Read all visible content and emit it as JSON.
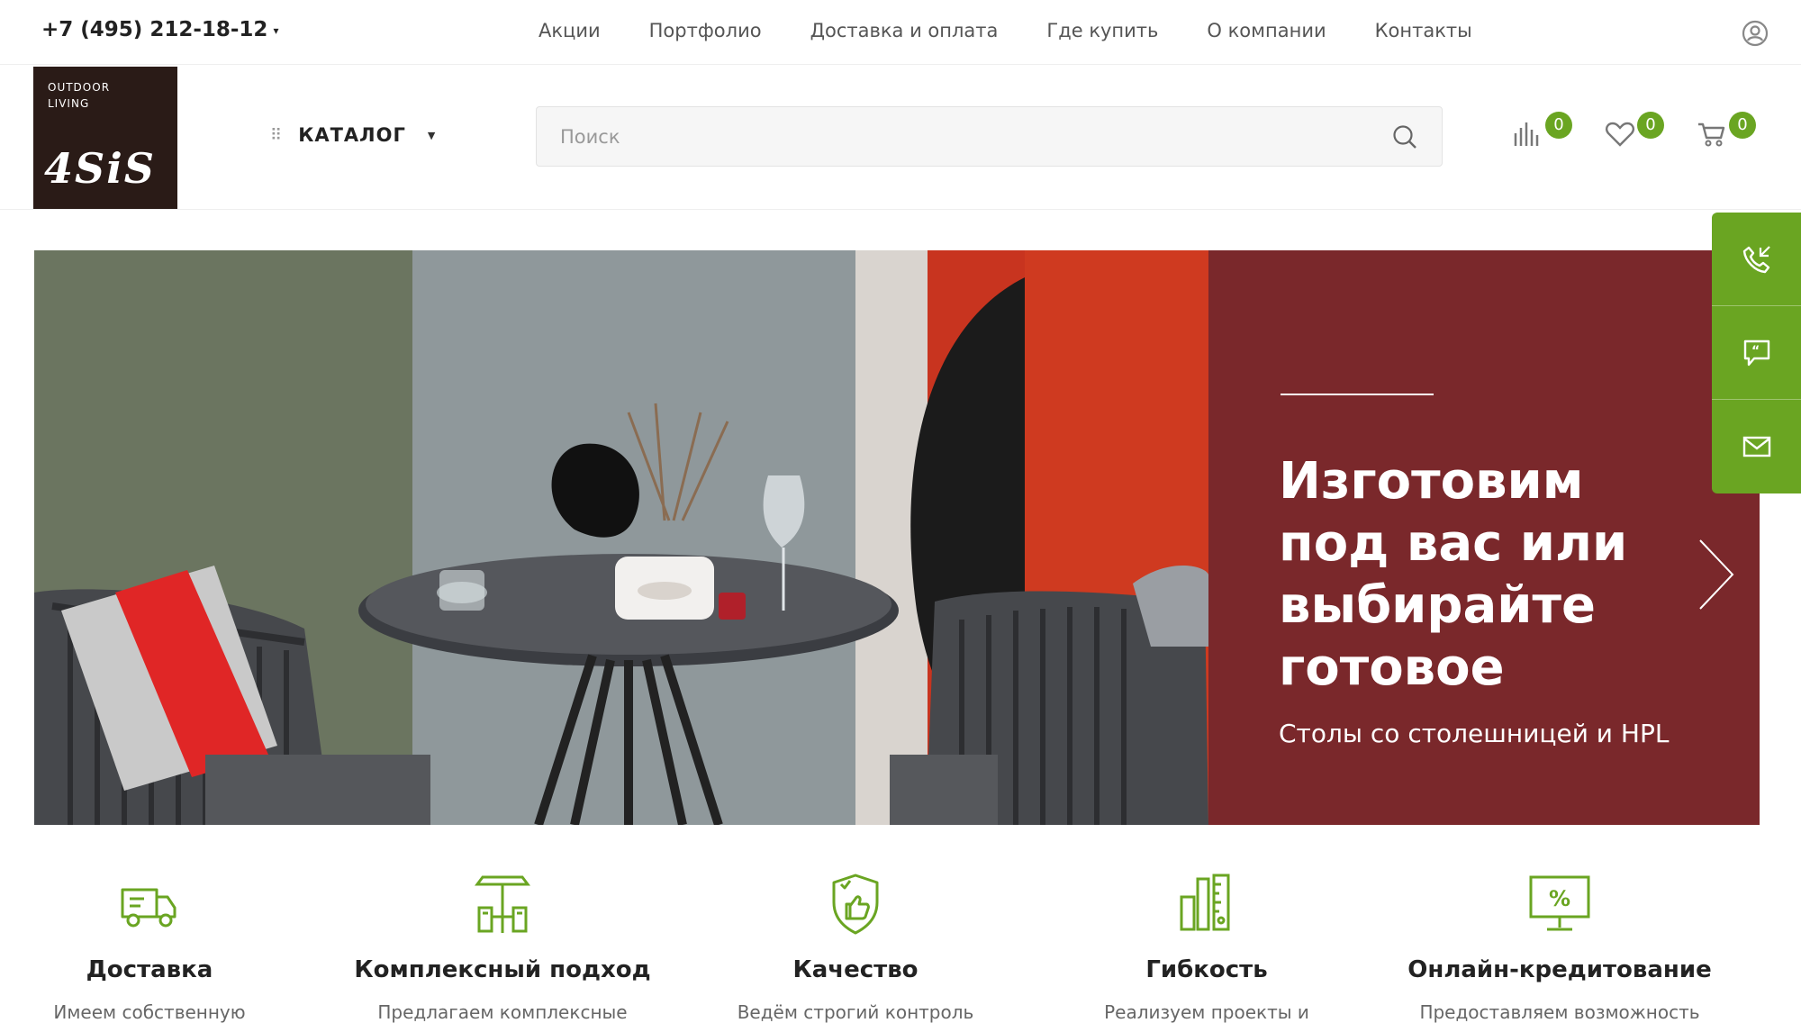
{
  "topbar": {
    "phone": "+7 (495) 212-18-12",
    "nav": [
      "Акции",
      "Портфолио",
      "Доставка и оплата",
      "Где купить",
      "О компании",
      "Контакты"
    ]
  },
  "header": {
    "logo_line1": "OUTDOOR",
    "logo_line2": "LIVING",
    "logo_brand": "4SiS",
    "catalog_label": "КАТАЛОГ",
    "search_placeholder": "Поиск",
    "counters": {
      "compare": "0",
      "favorites": "0",
      "cart": "0"
    }
  },
  "hero": {
    "headline": "Изготовим под вас или выбирайте готовое",
    "subtitle": "Столы со столешницей и HPL"
  },
  "features": [
    {
      "title": "Доставка",
      "desc": "Имеем собственную",
      "icon": "truck-icon"
    },
    {
      "title": "Комплексный подход",
      "desc": "Предлагаем комплексные",
      "icon": "cafe-set-icon"
    },
    {
      "title": "Качество",
      "desc": "Ведём строгий контроль",
      "icon": "shield-thumb-icon"
    },
    {
      "title": "Гибкость",
      "desc": "Реализуем проекты и",
      "icon": "measure-icon"
    },
    {
      "title": "Онлайн-кредитование",
      "desc": "Предоставляем возможность",
      "icon": "monitor-percent-icon"
    }
  ],
  "colors": {
    "accent": "#6aa522",
    "banner": "#7a282b",
    "logo_bg": "#2a1b17"
  }
}
